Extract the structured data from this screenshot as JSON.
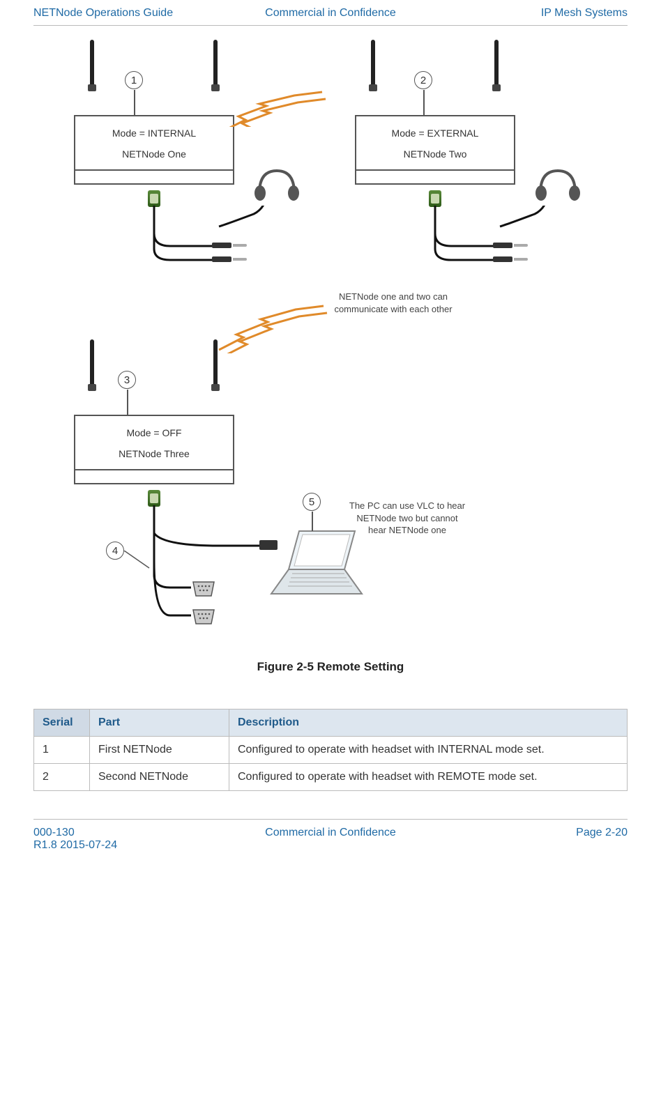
{
  "header": {
    "left": "NETNode Operations Guide",
    "center": "Commercial in Confidence",
    "right": "IP Mesh Systems"
  },
  "footer": {
    "left_line1": "000-130",
    "left_line2": "R1.8 2015-07-24",
    "center": "Commercial in Confidence",
    "right": "Page 2-20"
  },
  "diagram": {
    "node1": {
      "mode": "Mode = INTERNAL",
      "name": "NETNode One"
    },
    "node2": {
      "mode": "Mode = EXTERNAL",
      "name": "NETNode Two"
    },
    "node3": {
      "mode": "Mode = OFF",
      "name": "NETNode Three"
    },
    "callouts": {
      "c1": "1",
      "c2": "2",
      "c3": "3",
      "c4": "4",
      "c5": "5"
    },
    "note_middle": "NETNode one and two can communicate with each other",
    "note_pc": "The PC can use VLC to hear NETNode two but cannot hear NETNode one"
  },
  "figure_caption": "Figure 2-5 Remote Setting",
  "table": {
    "headers": {
      "serial": "Serial",
      "part": "Part",
      "description": "Description"
    },
    "rows": [
      {
        "serial": "1",
        "part": "First NETNode",
        "description": "Configured to operate with headset with INTERNAL mode set."
      },
      {
        "serial": "2",
        "part": "Second NETNode",
        "description": "Configured to operate with headset with REMOTE mode set."
      }
    ]
  }
}
